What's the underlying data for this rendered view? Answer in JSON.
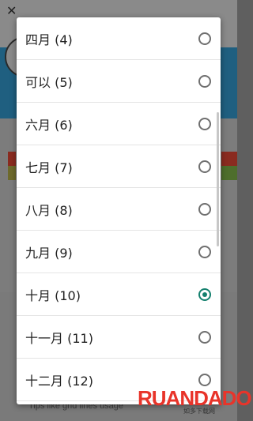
{
  "background": {
    "close_glyph": "✕",
    "tip_text": "Tips like grid lines usage"
  },
  "dialog": {
    "options": [
      {
        "label": "四月 (4)",
        "selected": false
      },
      {
        "label": "可以 (5)",
        "selected": false
      },
      {
        "label": "六月 (6)",
        "selected": false
      },
      {
        "label": "七月 (7)",
        "selected": false
      },
      {
        "label": "八月 (8)",
        "selected": false
      },
      {
        "label": "九月 (9)",
        "selected": false
      },
      {
        "label": "十月 (10)",
        "selected": true
      },
      {
        "label": "十一月 (11)",
        "selected": false
      },
      {
        "label": "十二月 (12)",
        "selected": false
      }
    ]
  },
  "watermark": {
    "brand": "RUANDADO",
    "subtitle": "如多下载网"
  },
  "colors": {
    "accent": "#14806e",
    "scrim": "#7a7a7a",
    "brand_band": "#1f5f80"
  }
}
